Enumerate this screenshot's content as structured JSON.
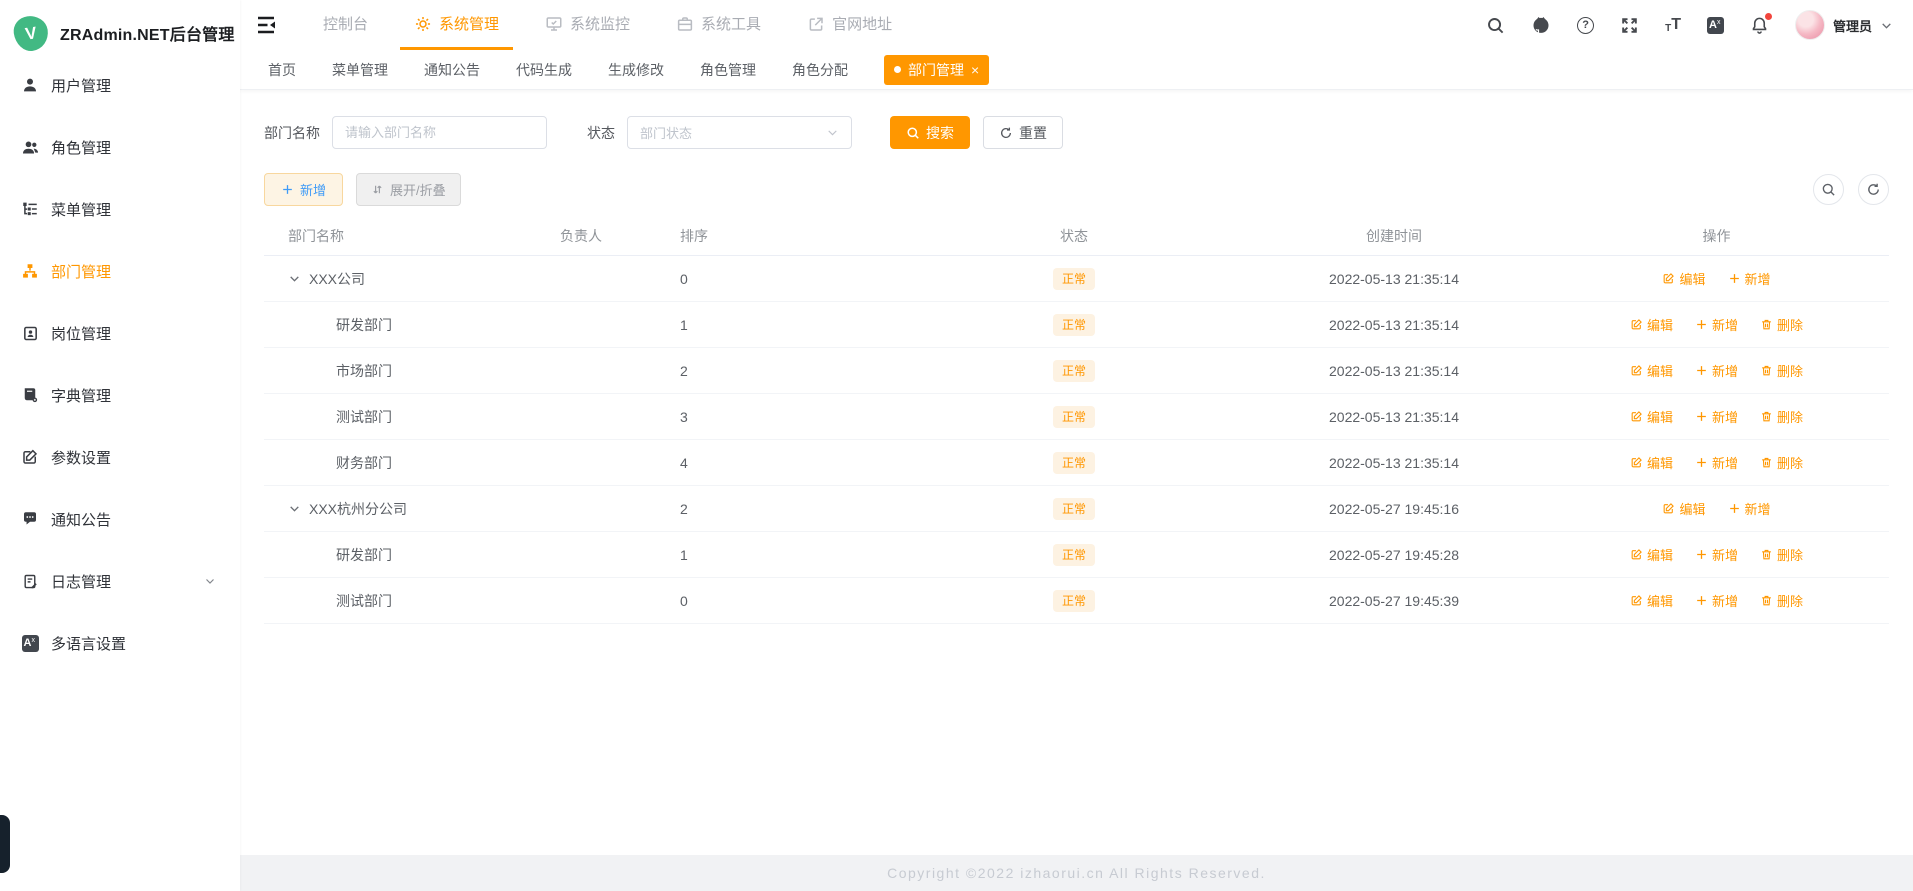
{
  "app": {
    "title": "ZRAdmin.NET后台管理",
    "logo_letter": "V"
  },
  "colors": {
    "accent": "#ff9700",
    "badge_bg": "#fdf2e2",
    "logo_green": "#42b983",
    "add_btn_text": "#3f9bf7"
  },
  "icons": {
    "translate_a": "A",
    "translate_x": "x",
    "help": "?",
    "t_small": "T",
    "t_big": "T"
  },
  "sidebar": {
    "items": [
      {
        "label": "用户管理"
      },
      {
        "label": "角色管理"
      },
      {
        "label": "菜单管理"
      },
      {
        "label": "部门管理",
        "active": true
      },
      {
        "label": "岗位管理"
      },
      {
        "label": "字典管理"
      },
      {
        "label": "参数设置"
      },
      {
        "label": "通知公告"
      },
      {
        "label": "日志管理",
        "expandable": true
      },
      {
        "label": "多语言设置"
      }
    ]
  },
  "topnav": {
    "items": [
      {
        "label": "控制台"
      },
      {
        "label": "系统管理",
        "active": true
      },
      {
        "label": "系统监控"
      },
      {
        "label": "系统工具"
      },
      {
        "label": "官网地址"
      }
    ],
    "user": {
      "name": "管理员"
    }
  },
  "tabs": {
    "items": [
      "首页",
      "菜单管理",
      "通知公告",
      "代码生成",
      "生成修改",
      "角色管理",
      "角色分配"
    ],
    "active": "部门管理",
    "close_glyph": "×"
  },
  "filter": {
    "name_label": "部门名称",
    "name_placeholder": "请输入部门名称",
    "status_label": "状态",
    "status_placeholder": "部门状态",
    "search": "搜索",
    "reset": "重置"
  },
  "toolbar": {
    "add": "新增",
    "expand": "展开/折叠"
  },
  "table": {
    "headers": {
      "name": "部门名称",
      "leader": "负责人",
      "order": "排序",
      "status": "状态",
      "created": "创建时间",
      "actions": "操作"
    },
    "action_labels": {
      "edit": "编辑",
      "add": "新增",
      "delete": "删除"
    },
    "rows": [
      {
        "name": "XXX公司",
        "leader": "",
        "order": "0",
        "status": "正常",
        "created": "2022-05-13 21:35:14",
        "parent": true
      },
      {
        "name": "研发部门",
        "leader": "",
        "order": "1",
        "status": "正常",
        "created": "2022-05-13 21:35:14"
      },
      {
        "name": "市场部门",
        "leader": "",
        "order": "2",
        "status": "正常",
        "created": "2022-05-13 21:35:14"
      },
      {
        "name": "测试部门",
        "leader": "",
        "order": "3",
        "status": "正常",
        "created": "2022-05-13 21:35:14"
      },
      {
        "name": "财务部门",
        "leader": "",
        "order": "4",
        "status": "正常",
        "created": "2022-05-13 21:35:14"
      },
      {
        "name": "XXX杭州分公司",
        "leader": "",
        "order": "2",
        "status": "正常",
        "created": "2022-05-27 19:45:16",
        "parent": true
      },
      {
        "name": "研发部门",
        "leader": "",
        "order": "1",
        "status": "正常",
        "created": "2022-05-27 19:45:28"
      },
      {
        "name": "测试部门",
        "leader": "",
        "order": "0",
        "status": "正常",
        "created": "2022-05-27 19:45:39"
      }
    ]
  },
  "footer": {
    "copyright": "Copyright ©2022 izhaorui.cn All Rights Reserved."
  }
}
